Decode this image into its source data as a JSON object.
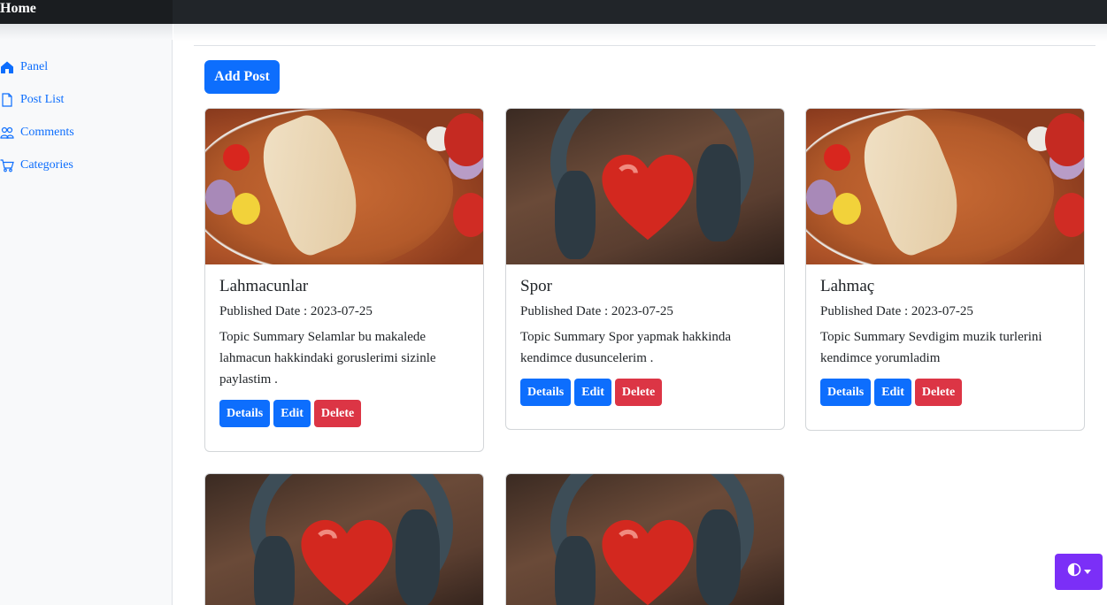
{
  "navbar": {
    "brand": "Home"
  },
  "sidebar": {
    "items": [
      {
        "label": "Panel",
        "icon": "house-icon"
      },
      {
        "label": "Post List",
        "icon": "file-icon"
      },
      {
        "label": "Comments",
        "icon": "people-icon"
      },
      {
        "label": "Categories",
        "icon": "cart-icon"
      }
    ]
  },
  "main": {
    "add_post_label": "Add Post",
    "posts": [
      {
        "title": "Lahmacunlar",
        "date_label": "Published Date : 2023-07-25",
        "summary": "Topic Summary Selamlar bu makalede lahmacun hakkindaki goruslerimi sizinle paylastim .",
        "image": "lahmacun-photo",
        "details_label": "Details",
        "edit_label": "Edit",
        "delete_label": "Delete"
      },
      {
        "title": "Spor",
        "date_label": "Published Date : 2023-07-25",
        "summary": "Topic Summary Spor yapmak hakkinda kendimce dusuncelerim .",
        "image": "heart-headphones-photo",
        "details_label": "Details",
        "edit_label": "Edit",
        "delete_label": "Delete"
      },
      {
        "title": "Lahmaç",
        "date_label": "Published Date : 2023-07-25",
        "summary": "Topic Summary Sevdigim muzik turlerini kendimce yorumladim",
        "image": "lahmacun-photo",
        "details_label": "Details",
        "edit_label": "Edit",
        "delete_label": "Delete"
      },
      {
        "image": "heart-headphones-photo"
      },
      {
        "image": "heart-headphones-photo"
      }
    ]
  },
  "theme_toggle": {
    "icon": "half-circle-icon"
  },
  "colors": {
    "primary": "#0d6efd",
    "danger": "#dc3545",
    "navbar": "#212529",
    "theme_button": "#7b2ff7"
  }
}
